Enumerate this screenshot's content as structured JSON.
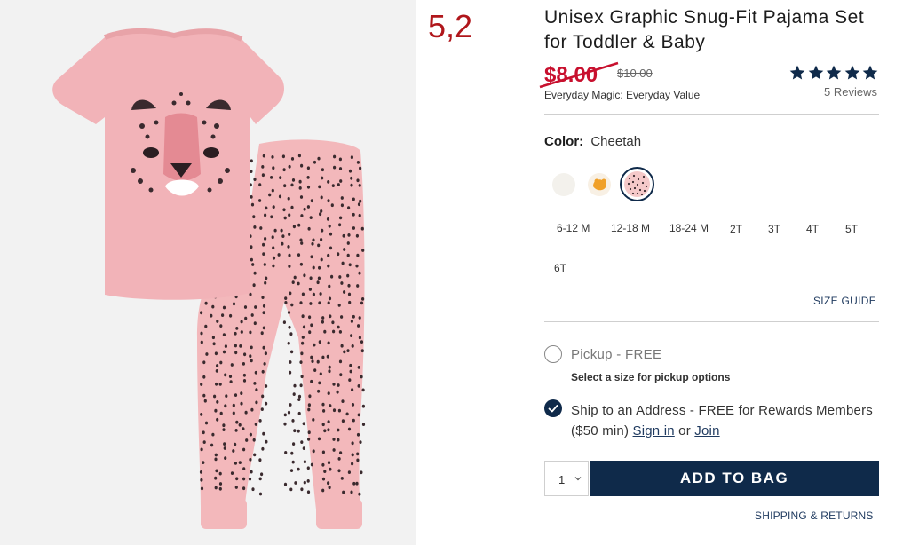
{
  "annotation": "5,2",
  "product": {
    "title": "Unisex Graphic Snug-Fit Pajama Set for Toddler & Baby",
    "sale_price": "$8.00",
    "original_price": "$10.00",
    "value_note": "Everyday Magic: Everyday Value",
    "rating": 5,
    "reviews_label": "5 Reviews"
  },
  "color": {
    "label": "Color:",
    "selected": "Cheetah",
    "swatches": [
      "white",
      "orange-print",
      "cheetah"
    ]
  },
  "sizes": [
    "6-12 M",
    "12-18 M",
    "18-24 M",
    "2T",
    "3T",
    "4T",
    "5T",
    "6T"
  ],
  "size_guide": "SIZE GUIDE",
  "fulfillment": {
    "pickup_label": "Pickup - FREE",
    "pickup_note": "Select a size for pickup options",
    "ship_text": "Ship to an Address - FREE for Rewards Members ($50 min)",
    "sign_in": "Sign in",
    "or": "or",
    "join": "Join"
  },
  "purchase": {
    "quantity": "1",
    "add_to_bag": "ADD TO BAG",
    "shipping_returns": "SHIPPING & RETURNS"
  },
  "colors": {
    "navy": "#0f2a4a",
    "sale_red": "#c8102e",
    "link_blue": "#1f3a5f",
    "pajama_pink": "#f3b8bb",
    "annotation_red": "#b0161b"
  }
}
